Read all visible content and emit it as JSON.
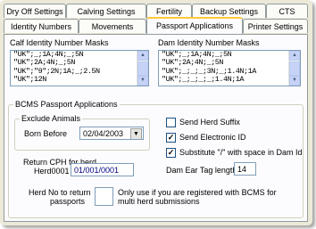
{
  "tabs_row1": [
    {
      "label": "Dry Off Settings"
    },
    {
      "label": "Calving Settings"
    },
    {
      "label": "Fertility"
    },
    {
      "label": "Backup Settings"
    },
    {
      "label": "CTS"
    }
  ],
  "tabs_row2": [
    {
      "label": "Identity Numbers"
    },
    {
      "label": "Movements"
    },
    {
      "label": "Passport Applications"
    },
    {
      "label": "Printer Settings"
    }
  ],
  "calf_masks": {
    "label": "Calf Identity Number Masks",
    "items": [
      "\"UK\";_;1A;4N;_;5N",
      "\"UK\";2A;4N;_;5N",
      "\"UK\";\"9\";2N;1A;_;2.5N",
      "\"UK\";12N"
    ]
  },
  "dam_masks": {
    "label": "Dam Identity Number Masks",
    "items": [
      "\"UK\";_;1A;4N;_;5N",
      "\"UK\";2A;4N;_;5N",
      "\"UK\";_;_;_;3N;_;1.4N;1A",
      "\"UK\";_;_;_;_;1.4N;1A"
    ]
  },
  "bcms": {
    "group_label": "BCMS Passport Applications",
    "exclude_label": "Exclude Animals",
    "born_before_label": "Born Before",
    "born_before_value": "02/04/2003",
    "send_herd_suffix_label": "Send Herd Suffix",
    "send_herd_suffix_checked": "",
    "send_electronic_id_label": "Send Electronic ID",
    "send_electronic_id_checked": "✓",
    "substitute_label": "Substitute \"/\" with space in Dam Id",
    "substitute_checked": "✓",
    "return_cph_label_1": "Return CPH for herd",
    "return_cph_label_2": "Herd0001",
    "return_cph_value": "01/001/0001",
    "dam_ear_tag_label": "Dam Ear Tag length",
    "dam_ear_tag_value": "14",
    "herd_no_label_1": "Herd No to return",
    "herd_no_label_2": "passports",
    "herd_no_value": "",
    "note_line_1": "Only use if you are registered with BCMS for",
    "note_line_2": "multi herd submissions"
  }
}
